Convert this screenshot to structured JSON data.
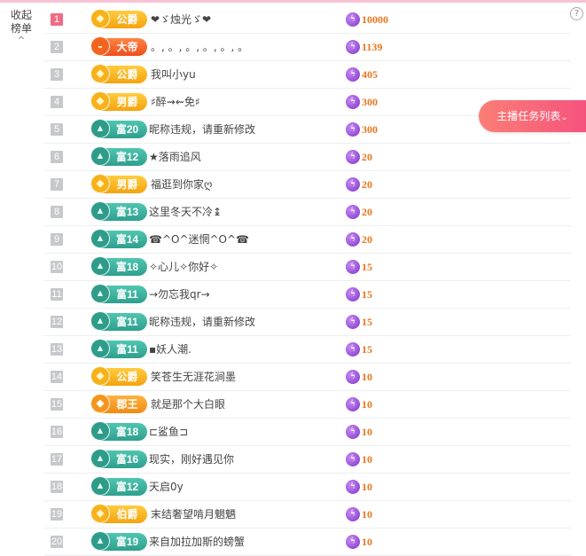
{
  "sidebar": {
    "collapse_label_1": "收起",
    "collapse_label_2": "榜单",
    "chevron": "^"
  },
  "help": {
    "icon": "?"
  },
  "task_button": {
    "label": "主播任务列表",
    "chevron": "⌄"
  },
  "rows": [
    {
      "rank": "1",
      "badge": "公爵",
      "badge_type": "noble",
      "badge_icon": "◆",
      "name": "❤ゞ烛光ゞ❤",
      "score": "10000"
    },
    {
      "rank": "2",
      "badge": "大帝",
      "badge_type": "emperor",
      "badge_icon": "◒",
      "name": "。, 。, 。, 。, 。, 。",
      "score": "1139"
    },
    {
      "rank": "3",
      "badge": "公爵",
      "badge_type": "noble",
      "badge_icon": "◆",
      "name": "我叫小yu",
      "score": "405"
    },
    {
      "rank": "4",
      "badge": "男爵",
      "badge_type": "noble",
      "badge_icon": "◆",
      "name": "♯醉⇝⇜免♯",
      "score": "300"
    },
    {
      "rank": "5",
      "badge": "富20",
      "badge_type": "rich",
      "badge_icon": "▲",
      "name": "昵称违规，请重新修改",
      "score": "300"
    },
    {
      "rank": "6",
      "badge": "富12",
      "badge_type": "rich",
      "badge_icon": "▲",
      "name": "★落雨追风",
      "score": "20"
    },
    {
      "rank": "7",
      "badge": "男爵",
      "badge_type": "noble",
      "badge_icon": "◆",
      "name": "福逛到你家ღ",
      "score": "20"
    },
    {
      "rank": "8",
      "badge": "富13",
      "badge_type": "rich",
      "badge_icon": "▲",
      "name": "这里冬天不冷↨",
      "score": "20"
    },
    {
      "rank": "9",
      "badge": "富14",
      "badge_type": "rich",
      "badge_icon": "▲",
      "name": "☎^O^迷惘^O^☎",
      "score": "20"
    },
    {
      "rank": "10",
      "badge": "富18",
      "badge_type": "rich",
      "badge_icon": "▲",
      "name": "✧心儿✧你好✧",
      "score": "15"
    },
    {
      "rank": "11",
      "badge": "富11",
      "badge_type": "rich",
      "badge_icon": "▲",
      "name": "→勿忘我qr→",
      "score": "15"
    },
    {
      "rank": "12",
      "badge": "富11",
      "badge_type": "rich",
      "badge_icon": "▲",
      "name": "昵称违规，请重新修改",
      "score": "15"
    },
    {
      "rank": "13",
      "badge": "富11",
      "badge_type": "rich",
      "badge_icon": "▲",
      "name": "▪妖人潮.",
      "score": "15"
    },
    {
      "rank": "14",
      "badge": "公爵",
      "badge_type": "noble",
      "badge_icon": "◆",
      "name": "笑苍生无涯花涧墨",
      "score": "10"
    },
    {
      "rank": "15",
      "badge": "郡王",
      "badge_type": "king",
      "badge_icon": "◆",
      "name": "就是那个大白眼",
      "score": "10"
    },
    {
      "rank": "16",
      "badge": "富18",
      "badge_type": "rich",
      "badge_icon": "▲",
      "name": "⊏鲨鱼⊐",
      "score": "10"
    },
    {
      "rank": "17",
      "badge": "富16",
      "badge_type": "rich",
      "badge_icon": "▲",
      "name": "现实，刚好遇见你",
      "score": "10"
    },
    {
      "rank": "18",
      "badge": "富12",
      "badge_type": "rich",
      "badge_icon": "▲",
      "name": "天启0y",
      "score": "10"
    },
    {
      "rank": "19",
      "badge": "伯爵",
      "badge_type": "noble",
      "badge_icon": "◆",
      "name": "末结奢望啃月魍魉",
      "score": "10"
    },
    {
      "rank": "20",
      "badge": "富19",
      "badge_type": "rich",
      "badge_icon": "▲",
      "name": "来自加拉加斯的螃蟹",
      "score": "10"
    }
  ],
  "colors": {
    "rank_first": "#f06b83",
    "rank_default": "#c6c8cb",
    "score_text": "#e8761d",
    "noble_badge": "#f5a30f",
    "emperor_badge": "#ee4f1c",
    "rich_badge": "#2f9f8e",
    "task_button": "#f5537e"
  },
  "icons": {
    "score": "lightning-icon",
    "help": "help-icon",
    "collapse": "chevron-up-icon"
  }
}
